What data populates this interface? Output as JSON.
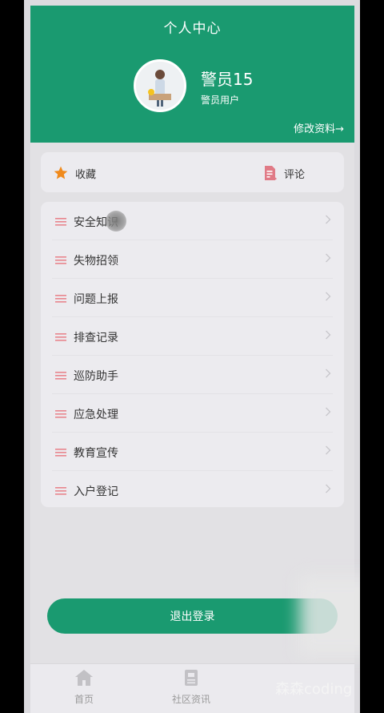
{
  "header": {
    "title": "个人中心",
    "username": "警员15",
    "user_type": "警员用户",
    "edit_profile": "修改资料→"
  },
  "quick_actions": [
    {
      "label": "收藏",
      "icon": "star-icon"
    },
    {
      "label": "评论",
      "icon": "comment-doc-icon"
    }
  ],
  "menu": [
    {
      "label": "安全知识"
    },
    {
      "label": "失物招领"
    },
    {
      "label": "问题上报"
    },
    {
      "label": "排查记录"
    },
    {
      "label": "巡防助手"
    },
    {
      "label": "应急处理"
    },
    {
      "label": "教育宣传"
    },
    {
      "label": "入户登记"
    }
  ],
  "logout_label": "退出登录",
  "tabbar": [
    {
      "label": "首页",
      "icon": "home-icon"
    },
    {
      "label": "社区资讯",
      "icon": "news-icon"
    }
  ],
  "watermark": "森森coding",
  "colors": {
    "primary": "#1a9a70",
    "menu_icon": "#e8868e",
    "star": "#f08a1c"
  }
}
